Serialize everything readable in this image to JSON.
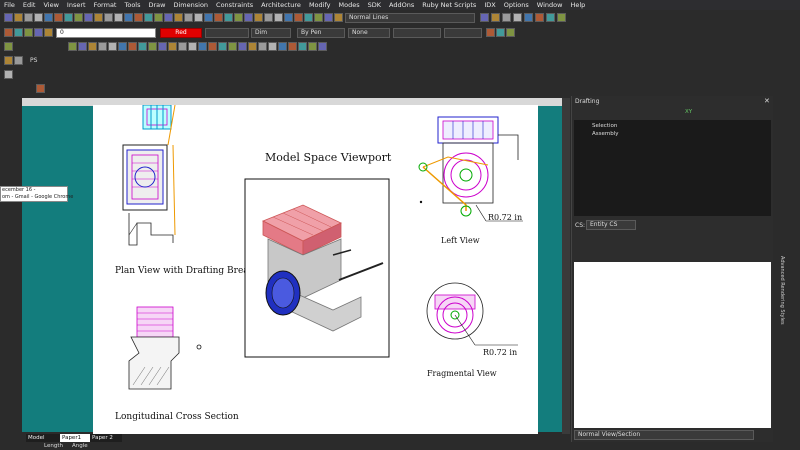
{
  "menu": [
    "File",
    "Edit",
    "View",
    "Insert",
    "Format",
    "Tools",
    "Draw",
    "Dimension",
    "Constraints",
    "Architecture",
    "Modify",
    "Modes",
    "SDK",
    "AddOns",
    "Ruby Net Scripts",
    "IDX",
    "Options",
    "Window",
    "Help"
  ],
  "toolbar": {
    "layer_value": "0",
    "color_value": "Red",
    "linetype_value": "Dim",
    "lineweight_value": "By Pen",
    "style_value": "None",
    "render_mode": "Normal Lines",
    "small_label": "PS"
  },
  "drawing": {
    "model_space_title": "Model Space Viewport",
    "plan_view_label": "Plan View with Drafting Break",
    "left_view_label": "Left View",
    "cross_section_label": "Longitudinal Cross Section",
    "fragmental_label": "Fragmental View",
    "dim_left_view": "R0.72 in",
    "dim_fragmental": "R0.72 in"
  },
  "tooltip": {
    "line1": "ecember 16 -",
    "line2": "om - Gmail - Google Chrome"
  },
  "tabs": [
    "Model",
    "Paper1",
    "Paper 2"
  ],
  "status": {
    "length_label": "Length",
    "angle_label": "Angle"
  },
  "panel": {
    "title": "Drafting",
    "tree": [
      "Selection",
      "Assembly"
    ],
    "cs_label": "CS:",
    "cs_value": "Entity CS",
    "bottom_value": "Normal View/Section",
    "side_tab": "Advanced Rendering Styles",
    "small_label": "XY"
  },
  "colors": {
    "teal_background": "#137d7d",
    "red_color_swatch": "#e00000",
    "ui_dark": "#2b2b2b"
  }
}
